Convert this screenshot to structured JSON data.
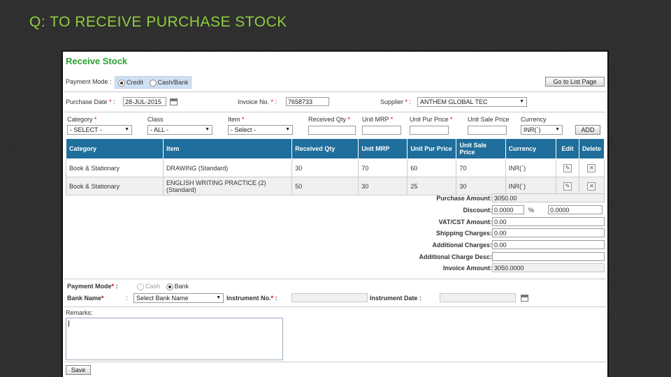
{
  "slide": {
    "title": "Q: TO RECEIVE PURCHASE STOCK"
  },
  "page": {
    "heading": "Receive Stock"
  },
  "header": {
    "payment_mode_label": "Payment Mode :",
    "credit_label": "Credit",
    "cashbank_label": "Cash/Bank",
    "go_to_list": "Go to List Page",
    "purchase_date_label": "Purchase Date",
    "purchase_date_value": "28-JUL-2015",
    "invoice_no_label": "Invoice No.",
    "invoice_no_value": "7658733",
    "supplier_label": "Supplier",
    "supplier_value": "ANTHEM GLOBAL TEC"
  },
  "entry": {
    "category_label": "Category",
    "category_value": "- SELECT -",
    "class_label": "Class",
    "class_value": "- ALL -",
    "item_label": "Item",
    "item_value": "- Select -",
    "received_qty_label": "Received Qty",
    "unit_mrp_label": "Unit MRP",
    "unit_pur_price_label": "Unit Pur Price",
    "unit_sale_price_label": "Unit Sale Price",
    "currency_label": "Currency",
    "currency_value": "INR(`)",
    "add_label": "ADD",
    "required_mark": "*",
    "colon": ":"
  },
  "table": {
    "headers": [
      "Category",
      "Item",
      "Received Qty",
      "Unit MRP",
      "Unit Pur Price",
      "Unit Sale Price",
      "Currency",
      "Edit",
      "Delete"
    ],
    "rows": [
      {
        "category": "Book & Stationary",
        "item": "DRAWING (Standard)",
        "qty": "30",
        "mrp": "70",
        "pur": "60",
        "sale": "70",
        "currency": "INR(`)"
      },
      {
        "category": "Book & Stationary",
        "item": "ENGLISH WRITING PRACTICE (2) (Standard)",
        "qty": "50",
        "mrp": "30",
        "pur": "25",
        "sale": "30",
        "currency": "INR(`)"
      }
    ]
  },
  "totals": {
    "purchase_amount_label": "Purchase Amount:",
    "purchase_amount_value": "3050.00",
    "discount_label": "Discount:",
    "discount_value": "0.0000",
    "discount_pct_symbol": "%",
    "discount_pct_value": "0.0000",
    "vat_label": "VAT/CST Amount:",
    "vat_value": "0.00",
    "shipping_label": "Shipping Charges:",
    "shipping_value": "0.00",
    "additional_label": "Additional Charges:",
    "additional_value": "0.00",
    "additional_desc_label": "Additional Charge Desc:",
    "additional_desc_value": "",
    "invoice_amount_label": "Invoice Amount:",
    "invoice_amount_value": "3050.0000"
  },
  "payment": {
    "mode_label": "Payment Mode",
    "cash_label": "Cash",
    "bank_label": "Bank",
    "bank_name_label": "Bank Name",
    "bank_name_value": "Select Bank Name",
    "instrument_no_label": "Instrument No.",
    "instrument_date_label": "Instrument Date"
  },
  "remarks": {
    "label": "Remarks:"
  },
  "save_label": "Save"
}
